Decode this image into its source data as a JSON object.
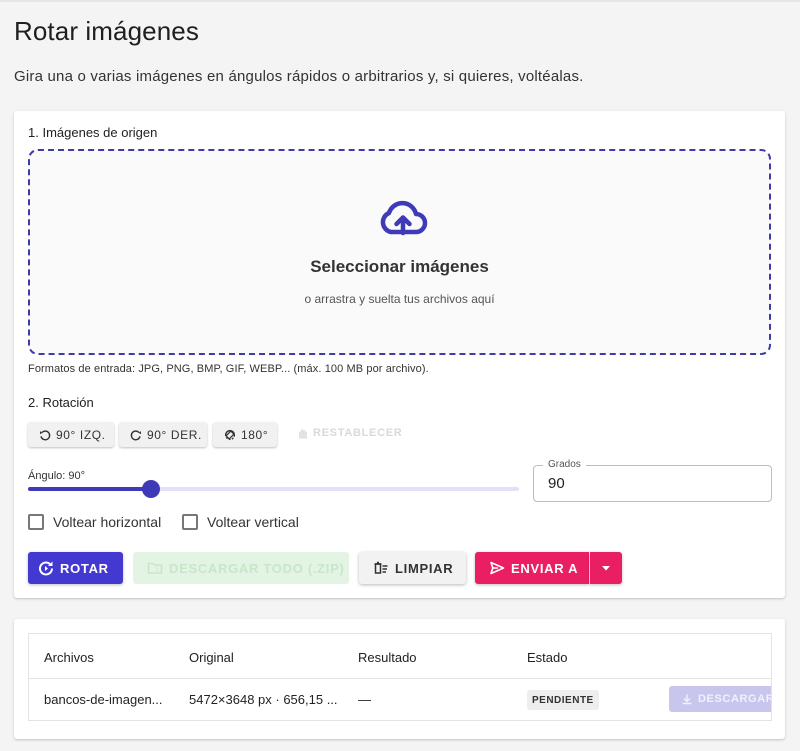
{
  "page": {
    "title": "Rotar imágenes",
    "subtitle": "Gira una o varias imágenes en ángulos rápidos o arbitrarios y, si quieres, voltéalas."
  },
  "source": {
    "section_label": "1. Imágenes de origen",
    "drop_title": "Seleccionar imágenes",
    "drop_subtitle": "o arrastra y suelta tus archivos aquí",
    "formats_note": "Formatos de entrada: JPG, PNG, BMP, GIF, WEBP... (máx. 100 MB por archivo)."
  },
  "rotation": {
    "section_label": "2. Rotación",
    "quick_buttons": {
      "left": "90° IZQ.",
      "right": "90° DER.",
      "flip180": "180°",
      "reset": "RESTABLECER"
    },
    "angle_label": "Ángulo: 90°",
    "angle_value": 90,
    "slider_fraction": 0.25,
    "degrees_label": "Grados",
    "degrees_value": "90",
    "flip_horizontal": {
      "label": "Voltear horizontal",
      "checked": false
    },
    "flip_vertical": {
      "label": "Voltear vertical",
      "checked": false
    }
  },
  "actions": {
    "rotate": "ROTAR",
    "download_all": "DESCARGAR TODO (.ZIP)",
    "clear": "LIMPIAR",
    "send_to": "ENVIAR A"
  },
  "files_table": {
    "headers": [
      "Archivos",
      "Original",
      "Resultado",
      "Estado"
    ],
    "rows": [
      {
        "file": "bancos-de-imagen...",
        "original": "5472×3648 px · 656,15 ...",
        "result": "—",
        "status": "PENDIENTE",
        "download": "DESCARGAR"
      }
    ]
  },
  "colors": {
    "primary": "#4338d0",
    "accent": "#e91e63",
    "dropzone_border": "#3f3aa8",
    "success_disabled": "#e3f4e4"
  }
}
